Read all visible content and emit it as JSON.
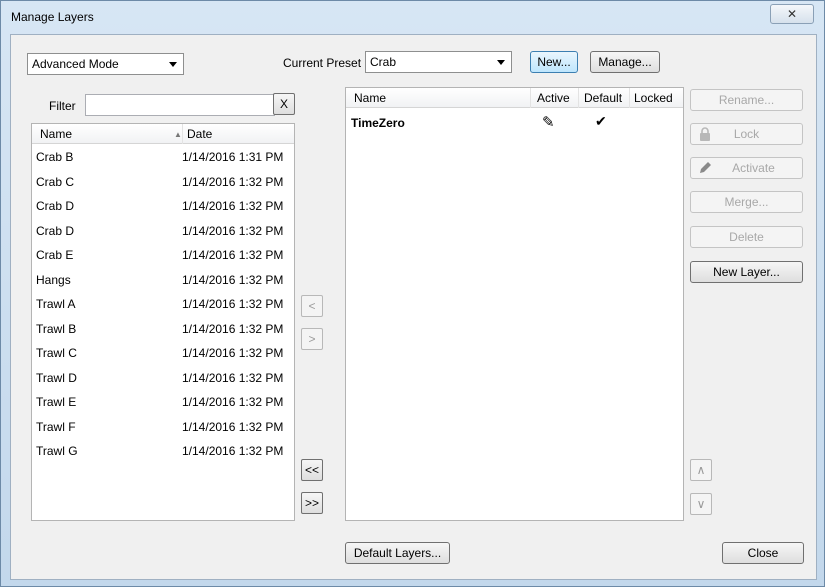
{
  "window": {
    "title": "Manage Layers",
    "close_glyph": "✕"
  },
  "top": {
    "mode_select": "Advanced Mode",
    "preset_label": "Current Preset",
    "preset_select": "Crab",
    "new_button": "New...",
    "manage_button": "Manage..."
  },
  "left": {
    "filter_label": "Filter",
    "filter_value": "",
    "clear_button": "X",
    "columns": {
      "name": "Name",
      "date": "Date"
    },
    "sort_glyph": "▲",
    "rows": [
      {
        "name": "Crab B",
        "date": "1/14/2016 1:31 PM"
      },
      {
        "name": "Crab C",
        "date": "1/14/2016 1:32 PM"
      },
      {
        "name": "Crab D",
        "date": "1/14/2016 1:32 PM"
      },
      {
        "name": "Crab D",
        "date": "1/14/2016 1:32 PM"
      },
      {
        "name": "Crab E",
        "date": "1/14/2016 1:32 PM"
      },
      {
        "name": "Hangs",
        "date": "1/14/2016 1:32 PM"
      },
      {
        "name": "Trawl A",
        "date": "1/14/2016 1:32 PM"
      },
      {
        "name": "Trawl B",
        "date": "1/14/2016 1:32 PM"
      },
      {
        "name": "Trawl C",
        "date": "1/14/2016 1:32 PM"
      },
      {
        "name": "Trawl D",
        "date": "1/14/2016 1:32 PM"
      },
      {
        "name": "Trawl E",
        "date": "1/14/2016 1:32 PM"
      },
      {
        "name": "Trawl F",
        "date": "1/14/2016 1:32 PM"
      },
      {
        "name": "Trawl G",
        "date": "1/14/2016 1:32 PM"
      }
    ]
  },
  "middle": {
    "add_one": "<",
    "remove_one": ">",
    "add_all": "<<",
    "remove_all": ">>"
  },
  "right": {
    "columns": {
      "name": "Name",
      "active": "Active",
      "default": "Default",
      "locked": "Locked"
    },
    "rows": [
      {
        "name": "TimeZero",
        "active_icon": "pencil-icon",
        "default_icon": "checkmark-icon",
        "active_glyph": "✎",
        "default_glyph": "✔"
      }
    ]
  },
  "side_buttons": {
    "rename": "Rename...",
    "lock": "Lock",
    "activate": "Activate",
    "merge": "Merge...",
    "delete": "Delete",
    "new_layer": "New Layer...",
    "move_up": "∧",
    "move_down": "∨"
  },
  "bottom": {
    "default_layers": "Default Layers...",
    "close": "Close"
  }
}
